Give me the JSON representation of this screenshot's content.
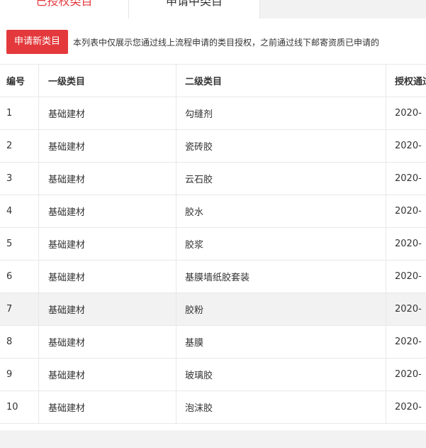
{
  "tabs": [
    {
      "label": "已授权类目",
      "active": true
    },
    {
      "label": "申请中类目",
      "active": false
    }
  ],
  "toolbar": {
    "apply_button": "申请新类目",
    "notice": "本列表中仅展示您通过线上流程申请的类目授权，之前通过线下邮寄资质已申请的"
  },
  "table": {
    "headers": {
      "no": "编号",
      "level1": "一级类目",
      "level2": "二级类目",
      "date": "授权通过时间"
    },
    "rows": [
      {
        "no": "1",
        "level1": "基础建材",
        "level2": "勾缝剂",
        "date": "2020-"
      },
      {
        "no": "2",
        "level1": "基础建材",
        "level2": "瓷砖胶",
        "date": "2020-"
      },
      {
        "no": "3",
        "level1": "基础建材",
        "level2": "云石胶",
        "date": "2020-"
      },
      {
        "no": "4",
        "level1": "基础建材",
        "level2": "胶水",
        "date": "2020-"
      },
      {
        "no": "5",
        "level1": "基础建材",
        "level2": "胶浆",
        "date": "2020-"
      },
      {
        "no": "6",
        "level1": "基础建材",
        "level2": "基膜墙纸胶套装",
        "date": "2020-"
      },
      {
        "no": "7",
        "level1": "基础建材",
        "level2": "胶粉",
        "date": "2020-"
      },
      {
        "no": "8",
        "level1": "基础建材",
        "level2": "基膜",
        "date": "2020-"
      },
      {
        "no": "9",
        "level1": "基础建材",
        "level2": "玻璃胶",
        "date": "2020-"
      },
      {
        "no": "10",
        "level1": "基础建材",
        "level2": "泡沫胶",
        "date": "2020-"
      }
    ],
    "highlighted_row": 7
  },
  "colors": {
    "accent": "#e4393c",
    "row_highlight": "#f2f2f2",
    "page_bg": "#f2f2f2"
  }
}
